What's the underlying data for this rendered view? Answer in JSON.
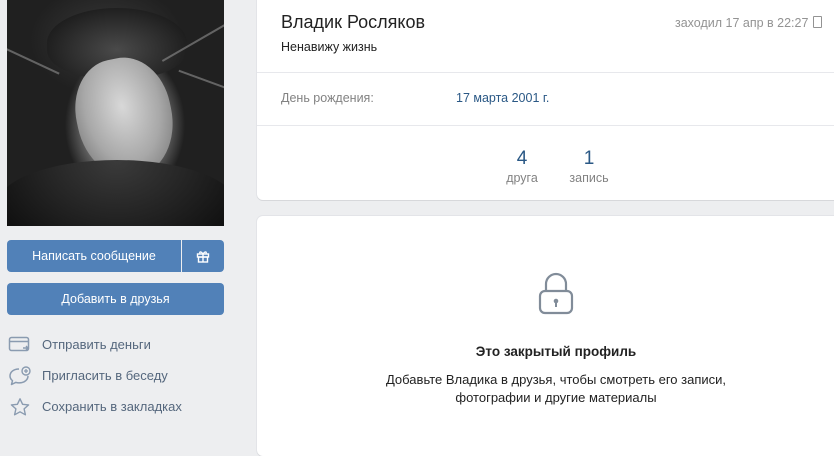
{
  "profile": {
    "name": "Владик Росляков",
    "status": "Ненавижу жизнь",
    "last_seen": "заходил 17 апр в 22:27",
    "info": {
      "birthday_label": "День рождения:",
      "birthday_value": "17 марта 2001 г."
    },
    "counters": [
      {
        "value": "4",
        "label": "друга"
      },
      {
        "value": "1",
        "label": "запись"
      }
    ]
  },
  "buttons": {
    "message": "Написать сообщение",
    "add_friend": "Добавить в друзья",
    "gift_icon": "gift-icon"
  },
  "actions": [
    {
      "label": "Отправить деньги",
      "icon": "money-transfer-icon"
    },
    {
      "label": "Пригласить в беседу",
      "icon": "chat-invite-icon"
    },
    {
      "label": "Сохранить в закладках",
      "icon": "star-icon"
    }
  ],
  "closed_profile": {
    "title": "Это закрытый профиль",
    "description_line1": "Добавьте Владика в друзья, чтобы смотреть его записи,",
    "description_line2": "фотографии и другие материалы",
    "icon": "lock-icon"
  },
  "colors": {
    "accent": "#5181b8",
    "link": "#2a5885",
    "background": "#edeef0"
  }
}
